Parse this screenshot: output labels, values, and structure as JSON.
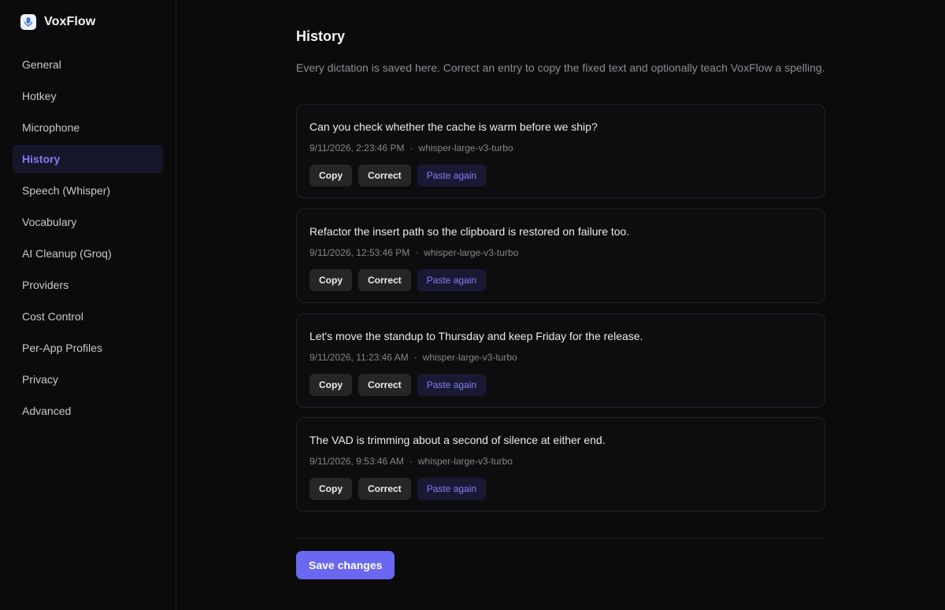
{
  "app": {
    "name": "VoxFlow",
    "logo_icon": "microphone-icon"
  },
  "sidebar": {
    "active_index": 3,
    "items": [
      {
        "label": "General"
      },
      {
        "label": "Hotkey"
      },
      {
        "label": "Microphone"
      },
      {
        "label": "History"
      },
      {
        "label": "Speech (Whisper)"
      },
      {
        "label": "Vocabulary"
      },
      {
        "label": "AI Cleanup (Groq)"
      },
      {
        "label": "Providers"
      },
      {
        "label": "Cost Control"
      },
      {
        "label": "Per-App Profiles"
      },
      {
        "label": "Privacy"
      },
      {
        "label": "Advanced"
      }
    ]
  },
  "page": {
    "title": "History",
    "description": "Every dictation is saved here. Correct an entry to copy the fixed text and optionally teach VoxFlow a spelling."
  },
  "actions": {
    "copy": "Copy",
    "correct": "Correct",
    "paste_again": "Paste again"
  },
  "entries": [
    {
      "text": "Can you check whether the cache is warm before we ship?",
      "timestamp": "9/11/2026, 2:23:46 PM",
      "separator": "·",
      "model": "whisper-large-v3-turbo"
    },
    {
      "text": "Refactor the insert path so the clipboard is restored on failure too.",
      "timestamp": "9/11/2026, 12:53:46 PM",
      "separator": "·",
      "model": "whisper-large-v3-turbo"
    },
    {
      "text": "Let's move the standup to Thursday and keep Friday for the release.",
      "timestamp": "9/11/2026, 11:23:46 AM",
      "separator": "·",
      "model": "whisper-large-v3-turbo"
    },
    {
      "text": "The VAD is trimming about a second of silence at either end.",
      "timestamp": "9/11/2026, 9:53:46 AM",
      "separator": "·",
      "model": "whisper-large-v3-turbo"
    }
  ],
  "footer": {
    "save_label": "Save changes"
  },
  "colors": {
    "accent": "#6a67f0",
    "accent_text": "#7e7cf2",
    "background": "#0b0b0c"
  }
}
